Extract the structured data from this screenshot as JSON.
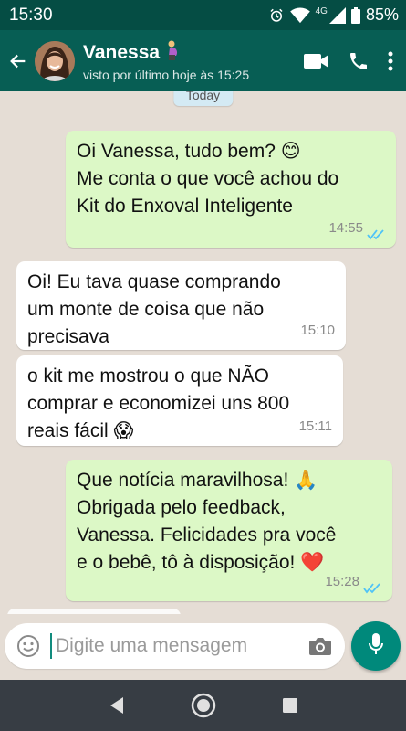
{
  "status_bar": {
    "time": "15:30",
    "network": "4G",
    "battery": "85%"
  },
  "header": {
    "contact_name": "Vanessa",
    "contact_emoji": "pregnant-woman-emoji",
    "last_seen": "visto por último hoje às 15:25",
    "icons": [
      "back-arrow-icon",
      "video-call-icon",
      "phone-icon",
      "more-vert-icon"
    ]
  },
  "chat": {
    "date_chip": "Today",
    "messages": [
      {
        "direction": "out",
        "text": "Oi Vanessa, tudo bem? 😊\nMe conta o que você achou do\nKit do Enxoval Inteligente",
        "time": "14:55",
        "status": "read"
      },
      {
        "direction": "in",
        "text": "Oi! Eu tava quase comprando\num monte de coisa que não\nprecisava",
        "time": "15:10"
      },
      {
        "direction": "in",
        "text": "o kit me mostrou o que NÃO\ncomprar e economizei uns 800\nreais fácil 😱",
        "time": "15:11"
      },
      {
        "direction": "out",
        "text": "Que notícia maravilhosa! 🙏\nObrigada pelo feedback,\nVanessa. Felicidades pra você\ne o bebê, tô à disposição! ❤️",
        "time": "15:28",
        "status": "read"
      }
    ]
  },
  "input": {
    "placeholder": "Digite uma mensagem"
  },
  "colors": {
    "header": "#075e54",
    "status_bar": "#054d44",
    "outgoing_bubble": "#dcf8c6",
    "incoming_bubble": "#ffffff",
    "chat_background": "#e5ddd5",
    "mic_button": "#00897b",
    "read_ticks": "#4fc3f7"
  }
}
